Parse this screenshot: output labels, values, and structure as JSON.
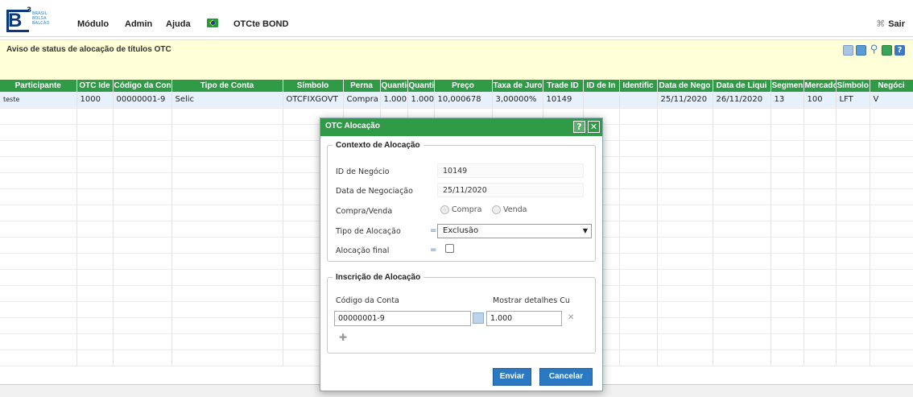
{
  "logo": {
    "letter": "B",
    "sup": "3",
    "words": [
      "BRASIL",
      "BOLSA",
      "BALCÃO"
    ]
  },
  "menu": {
    "modulo": "Módulo",
    "admin": "Admin",
    "ajuda": "Ajuda",
    "app_name": "OTCte BOND",
    "sair": "Sair"
  },
  "notice": {
    "title": "Aviso de status de alocação de títulos OTC"
  },
  "toolbar_icons": [
    "grid-icon",
    "export-icon",
    "search-icon",
    "excel-icon",
    "help-icon"
  ],
  "table": {
    "columns": [
      "Participante",
      "OTC Ide",
      "Código da Con",
      "Tipo de Conta",
      "Símbolo",
      "Perna",
      "Quantid",
      "Quantid",
      "Preço",
      "Taxa de Juro",
      "Trade ID",
      "ID de In",
      "Identific",
      "Data de Nego",
      "Data de Liqui",
      "Segmen",
      "Mercado",
      "Símbolo",
      "Negóci"
    ],
    "rows": [
      [
        "teste",
        "1000",
        "00000001-9",
        "Selic",
        "OTCFIXGOVT",
        "Compra",
        "1.000",
        "1.000",
        "10,000678",
        "3,00000%",
        "10149",
        "",
        "",
        "25/11/2020",
        "26/11/2020",
        "13",
        "100",
        "LFT",
        "V"
      ]
    ],
    "empty_rows": 16
  },
  "modal": {
    "title": "OTC Alocação",
    "help_label": "?",
    "close_label": "✕",
    "context": {
      "legend": "Contexto de Alocação",
      "id_negocio_label": "ID de Negócio",
      "id_negocio_value": "10149",
      "data_negociacao_label": "Data de Negociação",
      "data_negociacao_value": "25/11/2020",
      "compra_venda_label": "Compra/Venda",
      "compra_option": "Compra",
      "venda_option": "Venda",
      "compra_venda_selected": "Compra",
      "tipo_alocacao_label": "Tipo de Alocação",
      "tipo_alocacao_value": "Exclusão",
      "alocacao_final_label": "Alocação final",
      "alocacao_final_checked": false,
      "required_mark": "="
    },
    "inscricao": {
      "legend": "Inscrição de Alocação",
      "codigo_conta_label": "Código da Conta",
      "mostrar_detalhes_label": "Mostrar detalhes Cu",
      "codigo_conta_value": "00000001-9",
      "quantidade_value": "1.000",
      "remove_label": "✕",
      "add_label": "✚"
    },
    "buttons": {
      "enviar": "Enviar",
      "cancelar": "Cancelar"
    }
  }
}
